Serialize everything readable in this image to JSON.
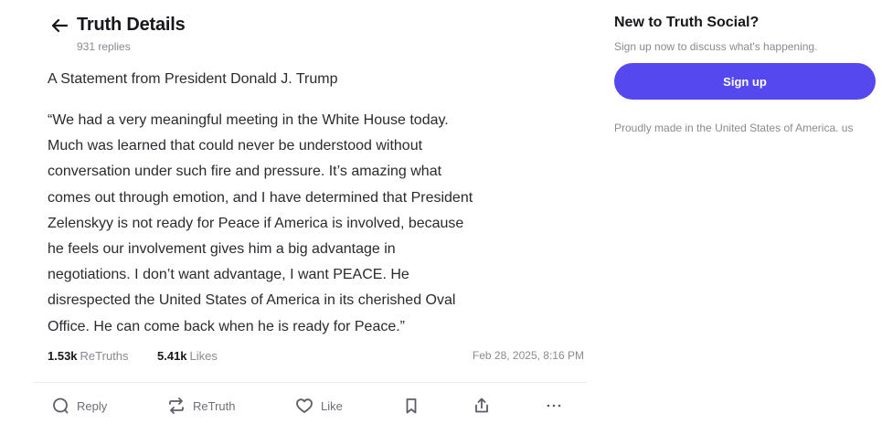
{
  "header": {
    "title": "Truth Details",
    "replies": "931 replies"
  },
  "post": {
    "heading": "A Statement from President Donald J. Trump",
    "body_lines": [
      "“We had a very meaningful meeting in the White House today.",
      "Much was learned that could never be understood without",
      "conversation under such fire and pressure. It’s amazing what",
      "comes out through emotion, and I have determined that President",
      "Zelenskyy is not ready for Peace if America is involved, because",
      "he feels our involvement gives him a big advantage in",
      "negotiations. I don’t want advantage, I want PEACE. He",
      "disrespected the United States of America in its cherished Oval",
      "Office. He can come back when he is ready for Peace.”"
    ],
    "retruths_count": "1.53k",
    "retruths_label": "ReTruths",
    "likes_count": "5.41k",
    "likes_label": "Likes",
    "timestamp": "Feb 28, 2025, 8:16 PM"
  },
  "actions": {
    "reply": "Reply",
    "retruth": "ReTruth",
    "like": "Like",
    "icons": [
      "reply-icon",
      "retruth-icon",
      "like-icon",
      "bookmark-icon",
      "share-icon",
      "more-icon"
    ]
  },
  "sidebar": {
    "title": "New to Truth Social?",
    "subtitle": "Sign up now to discuss what's happening.",
    "signup_label": "Sign up",
    "made_in": "Proudly made in the United States of America. us"
  },
  "colors": {
    "accent": "#5448ee",
    "text": "#2a2a30",
    "muted": "#8a8a93"
  }
}
